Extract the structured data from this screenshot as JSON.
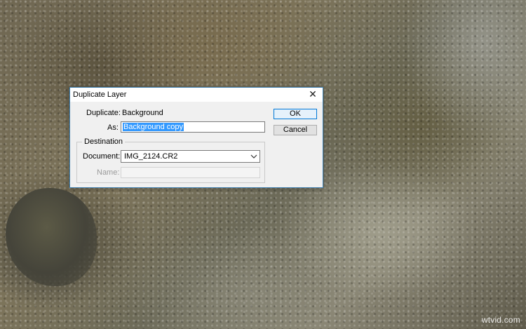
{
  "dialog": {
    "title": "Duplicate Layer",
    "close_glyph": "✕",
    "duplicate_label": "Duplicate:",
    "duplicate_value": "Background",
    "as_label": "As:",
    "as_value": "Background copy",
    "destination_legend": "Destination",
    "document_label": "Document:",
    "document_value": "IMG_2124.CR2",
    "name_label": "Name:",
    "name_value": "",
    "ok_label": "OK",
    "cancel_label": "Cancel"
  },
  "icons": {
    "close": "close-icon",
    "dropdown": "chevron-down-icon"
  },
  "watermark": "wtvid.com",
  "colors": {
    "selection": "#3399ff",
    "dialog_border": "#3c7fb1",
    "ok_border": "#0078d7"
  }
}
